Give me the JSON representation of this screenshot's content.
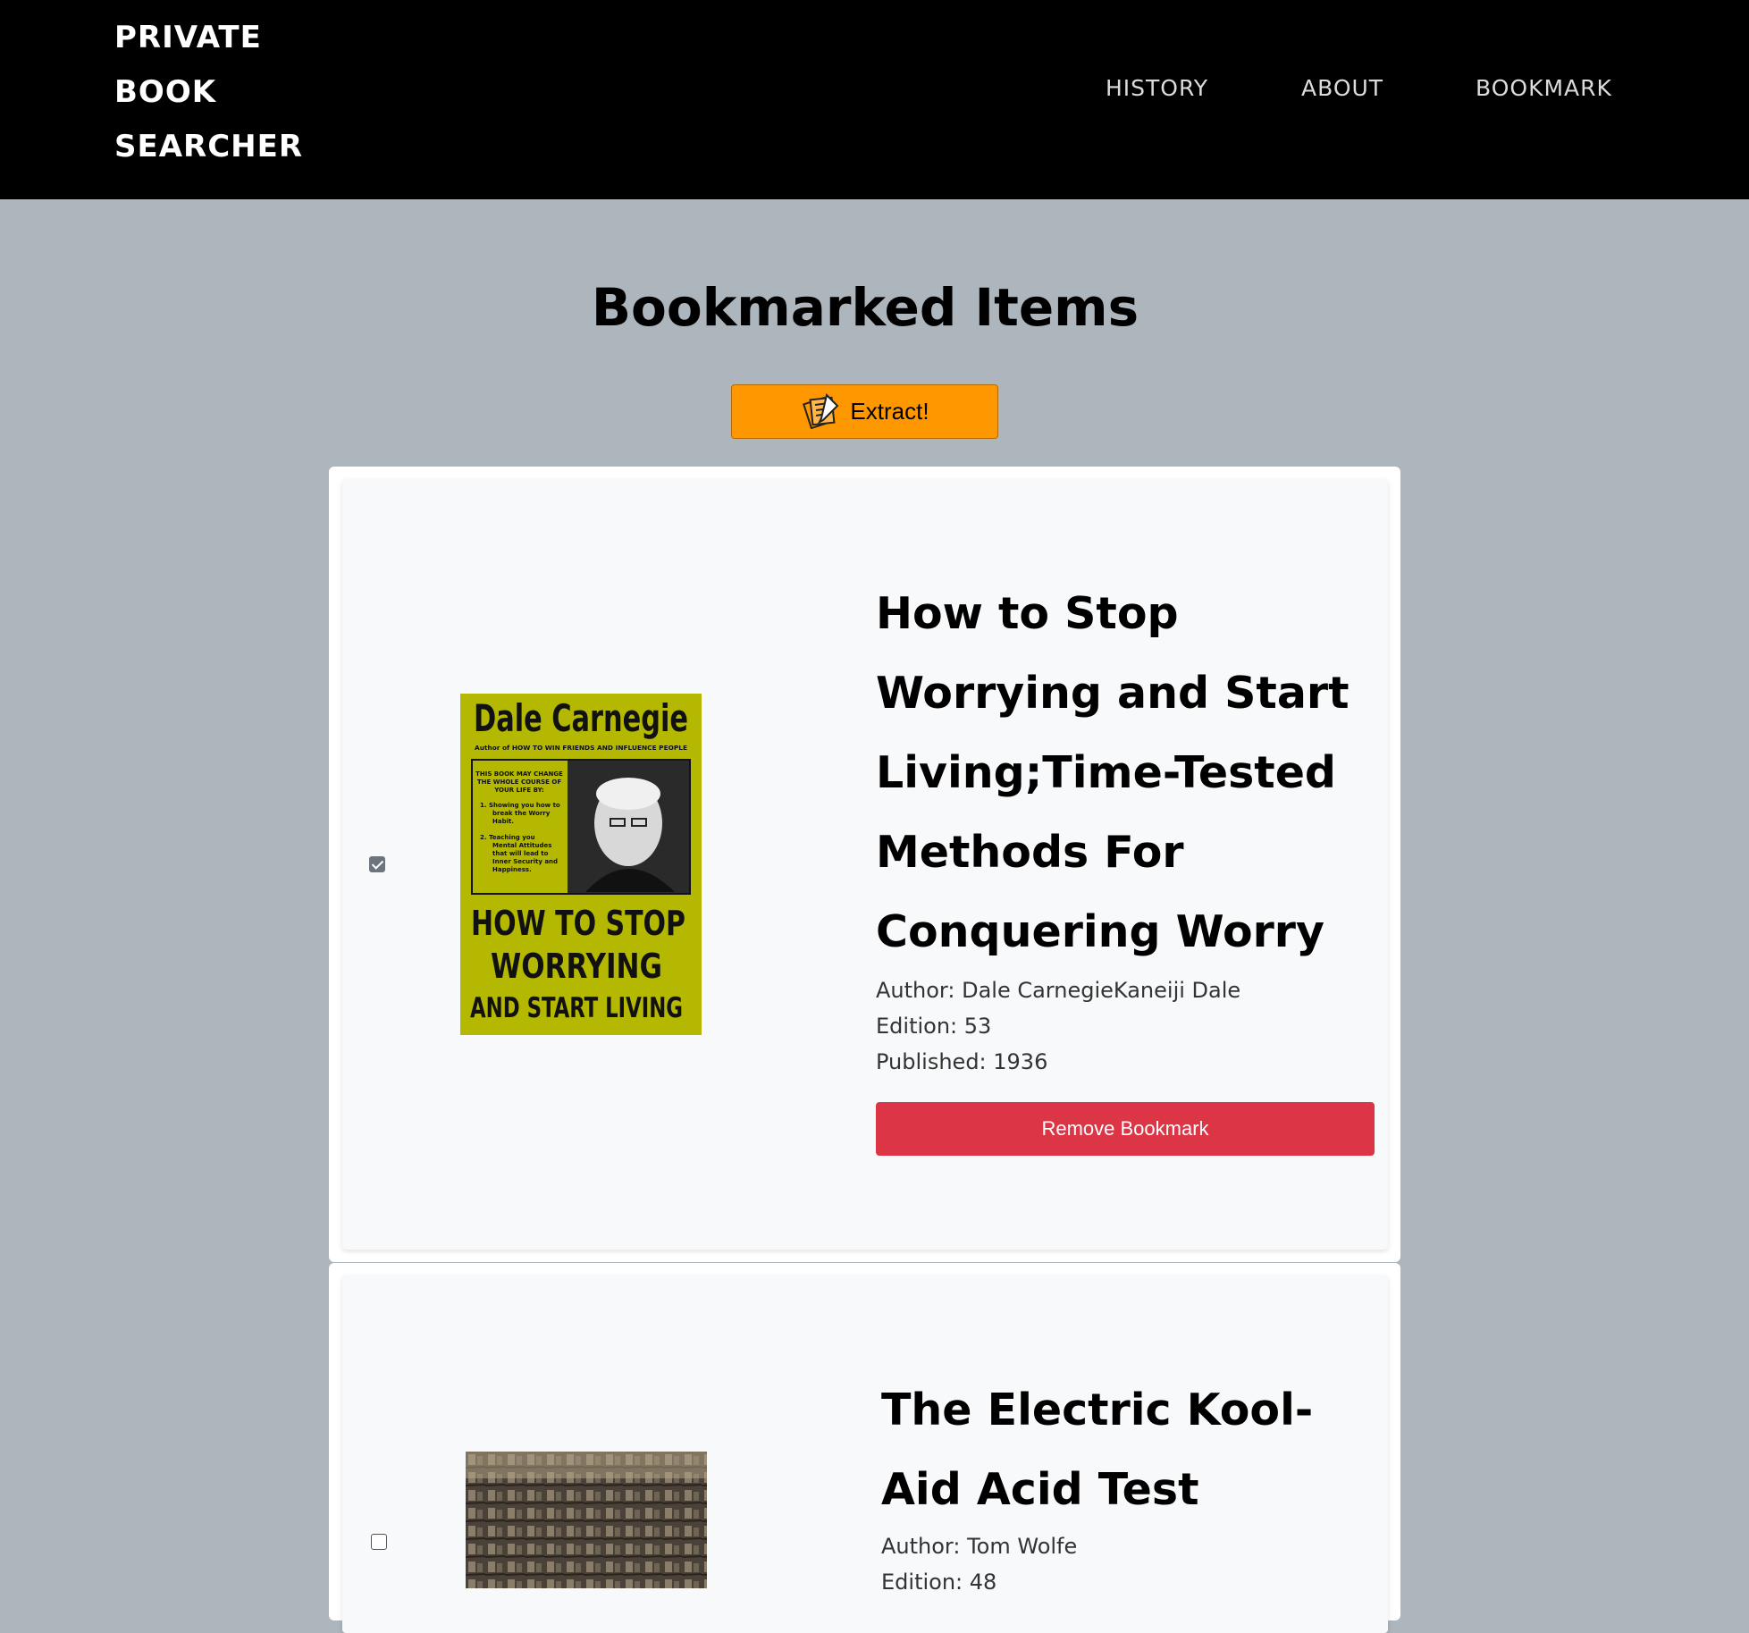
{
  "nav": {
    "brand_lines": [
      "PRIVATE",
      "BOOK",
      "SEARCHER"
    ],
    "links": [
      "HISTORY",
      "ABOUT",
      "BOOKMARK"
    ]
  },
  "page": {
    "title": "Bookmarked Items",
    "extract_label": "Extract!"
  },
  "books": [
    {
      "checked": true,
      "title": "How to Stop Worrying and Start Living;Time-Tested Methods For Conquering Worry",
      "author": "Author: Dale CarnegieKaneiji Dale",
      "edition": "Edition: 53",
      "published": "Published: 1936",
      "remove_label": "Remove Bookmark",
      "cover": {
        "author_text": "Dale Carnegie",
        "subtitle_text": "Author of HOW TO WIN FRIENDS AND INFLUENCE PEOPLE",
        "blurb": [
          "THIS BOOK MAY CHANGE",
          "THE WHOLE COURSE OF",
          "YOUR LIFE BY:",
          "1. Showing you how to",
          "break the Worry",
          "Habit.",
          "2. Teaching you",
          "Mental Attitudes",
          "that will lead to",
          "Inner Security and",
          "Happiness."
        ],
        "title_lines": [
          "HOW TO STOP",
          "WORRYING",
          "AND START LIVING"
        ],
        "color": "#b5b800"
      }
    },
    {
      "checked": false,
      "title": "The Electric Kool-Aid Acid Test",
      "author": "Author: Tom Wolfe",
      "edition": "Edition: 48"
    }
  ],
  "colors": {
    "background": "#adb5bd",
    "navbar": "#000000",
    "extract": "#ff9800",
    "remove": "#dc3545"
  }
}
